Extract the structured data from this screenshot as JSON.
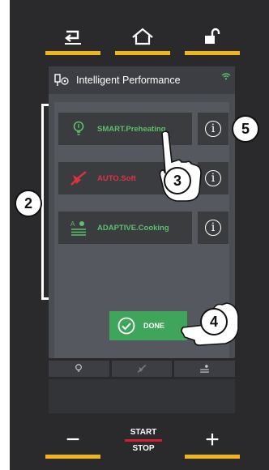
{
  "top_buttons": [
    {
      "name": "back",
      "icon": "back-arrow-icon"
    },
    {
      "name": "home",
      "icon": "home-icon"
    },
    {
      "name": "unlock",
      "icon": "unlock-icon"
    }
  ],
  "screen": {
    "header_title": "Intelligent Performance",
    "header_icon": "intelligent-performance-icon",
    "status_icon": "wifi-icon",
    "functions": [
      {
        "label": "SMART.Preheating",
        "label_color": "#5fbf6a",
        "icon": "smart-preheating-icon",
        "info_label": "i"
      },
      {
        "label": "AUTO.Soft",
        "label_color": "#e0323c",
        "icon": "auto-soft-icon",
        "info_label": "i"
      },
      {
        "label": "ADAPTIVE.Cooking",
        "label_color": "#5fbf6a",
        "icon": "adaptive-cooking-icon",
        "info_label": "i"
      }
    ],
    "done_label": "DONE",
    "done_color": "#3fa55a"
  },
  "tabs": [
    {
      "icon": "smart-preheating-icon"
    },
    {
      "icon": "auto-soft-icon"
    },
    {
      "icon": "adaptive-cooking-icon"
    }
  ],
  "bottom": {
    "minus": "−",
    "plus": "+",
    "start": "START",
    "stop": "STOP"
  },
  "callouts": {
    "c2": "2",
    "c3": "3",
    "c4": "4",
    "c5": "5"
  },
  "colors": {
    "accent_yellow": "#f1b51c",
    "start_stop_red": "#d31f32"
  }
}
